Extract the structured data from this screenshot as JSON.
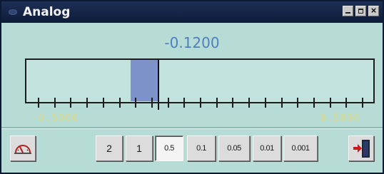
{
  "window": {
    "title": "Analog"
  },
  "display": {
    "value": "-0.1200",
    "scale_min_label": "-0.5000",
    "scale_max_label": "0.5000",
    "range": [
      -0.5,
      0.5
    ],
    "reading": -0.12,
    "fill_from": -0.2
  },
  "toolbar": {
    "left_icon": "gauge-icon",
    "right_icon": "exit-door-icon",
    "range_buttons": [
      {
        "label": "2",
        "selected": false
      },
      {
        "label": "1",
        "selected": false
      },
      {
        "label": "0.5",
        "selected": true
      },
      {
        "label": "0.1",
        "selected": false
      },
      {
        "label": "0.05",
        "selected": false
      },
      {
        "label": "0.01",
        "selected": false
      },
      {
        "label": "0.001",
        "selected": false
      }
    ]
  },
  "colors": {
    "panel_bg": "#b7dcd6",
    "meter_fill": "#7c92c9",
    "value_text": "#4f7fbf",
    "scale_label": "#d9d98a",
    "title_bar": "#0f1c3a"
  }
}
